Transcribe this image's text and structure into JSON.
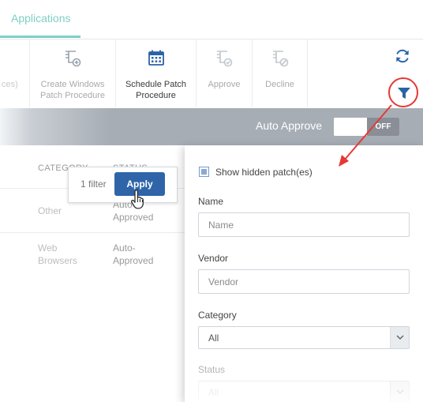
{
  "tabs": {
    "active_label": "Applications"
  },
  "toolbar": {
    "partial_label": "ces)",
    "create_windows": "Create Windows Patch Procedure",
    "schedule_patch": "Schedule Patch Procedure",
    "approve": "Approve",
    "decline": "Decline"
  },
  "auto_approve": {
    "label": "Auto Approve",
    "toggle_state": "OFF"
  },
  "table": {
    "headers": [
      "CATEGORY",
      "STATUS"
    ],
    "rows": [
      {
        "category": "Other",
        "status": "Auto-Approved"
      },
      {
        "category": "Web Browsers",
        "status": "Auto-Approved"
      }
    ]
  },
  "filter_tooltip": {
    "count": "1 filter",
    "apply_label": "Apply"
  },
  "filter_panel": {
    "show_hidden_label": "Show hidden patch(es)",
    "name_label": "Name",
    "name_placeholder": "Name",
    "vendor_label": "Vendor",
    "vendor_placeholder": "Vendor",
    "category_label": "Category",
    "category_value": "All",
    "status_label": "Status",
    "status_value": "All"
  },
  "colors": {
    "accent_teal": "#7fcfc4",
    "apply_blue": "#2f65a8",
    "highlight_red": "#e53935",
    "filter_icon_blue": "#2b63a6"
  }
}
